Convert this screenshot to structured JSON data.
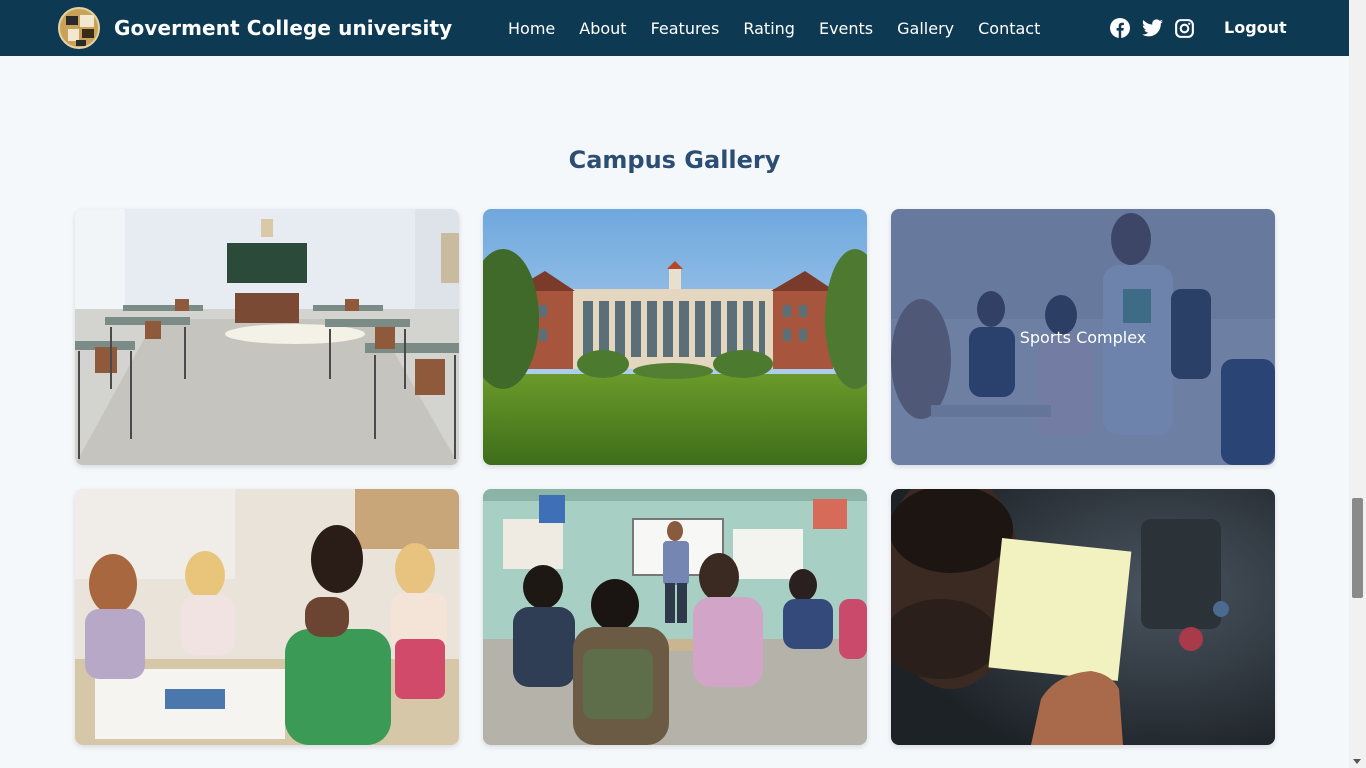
{
  "header": {
    "brand_name": "Goverment College university",
    "nav": [
      "Home",
      "About",
      "Features",
      "Rating",
      "Events",
      "Gallery",
      "Contact"
    ],
    "social_icons": [
      "facebook-icon",
      "twitter-icon",
      "instagram-icon"
    ],
    "logout_label": "Logout"
  },
  "gallery": {
    "title": "Campus Gallery",
    "hover_caption": "Sports Complex"
  }
}
